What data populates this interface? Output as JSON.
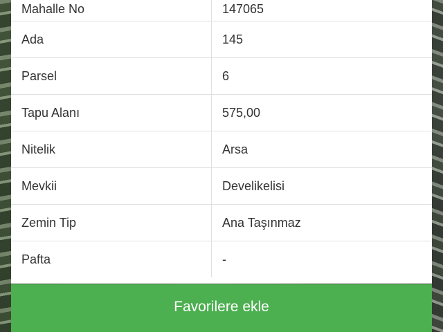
{
  "parcel_info": {
    "rows": [
      {
        "label": "Mahalle No",
        "value": "147065"
      },
      {
        "label": "Ada",
        "value": "145"
      },
      {
        "label": "Parsel",
        "value": "6"
      },
      {
        "label": "Tapu Alanı",
        "value": "575,00"
      },
      {
        "label": "Nitelik",
        "value": "Arsa"
      },
      {
        "label": "Mevkii",
        "value": "Develikelisi"
      },
      {
        "label": "Zemin Tip",
        "value": "Ana Taşınmaz"
      },
      {
        "label": "Pafta",
        "value": "-"
      }
    ]
  },
  "actions": {
    "favorite_label": "Favorilere ekle"
  },
  "colors": {
    "accent": "#4caf50",
    "card_background": "#ffffff",
    "text": "#333333",
    "divider": "#e0e0e0"
  }
}
